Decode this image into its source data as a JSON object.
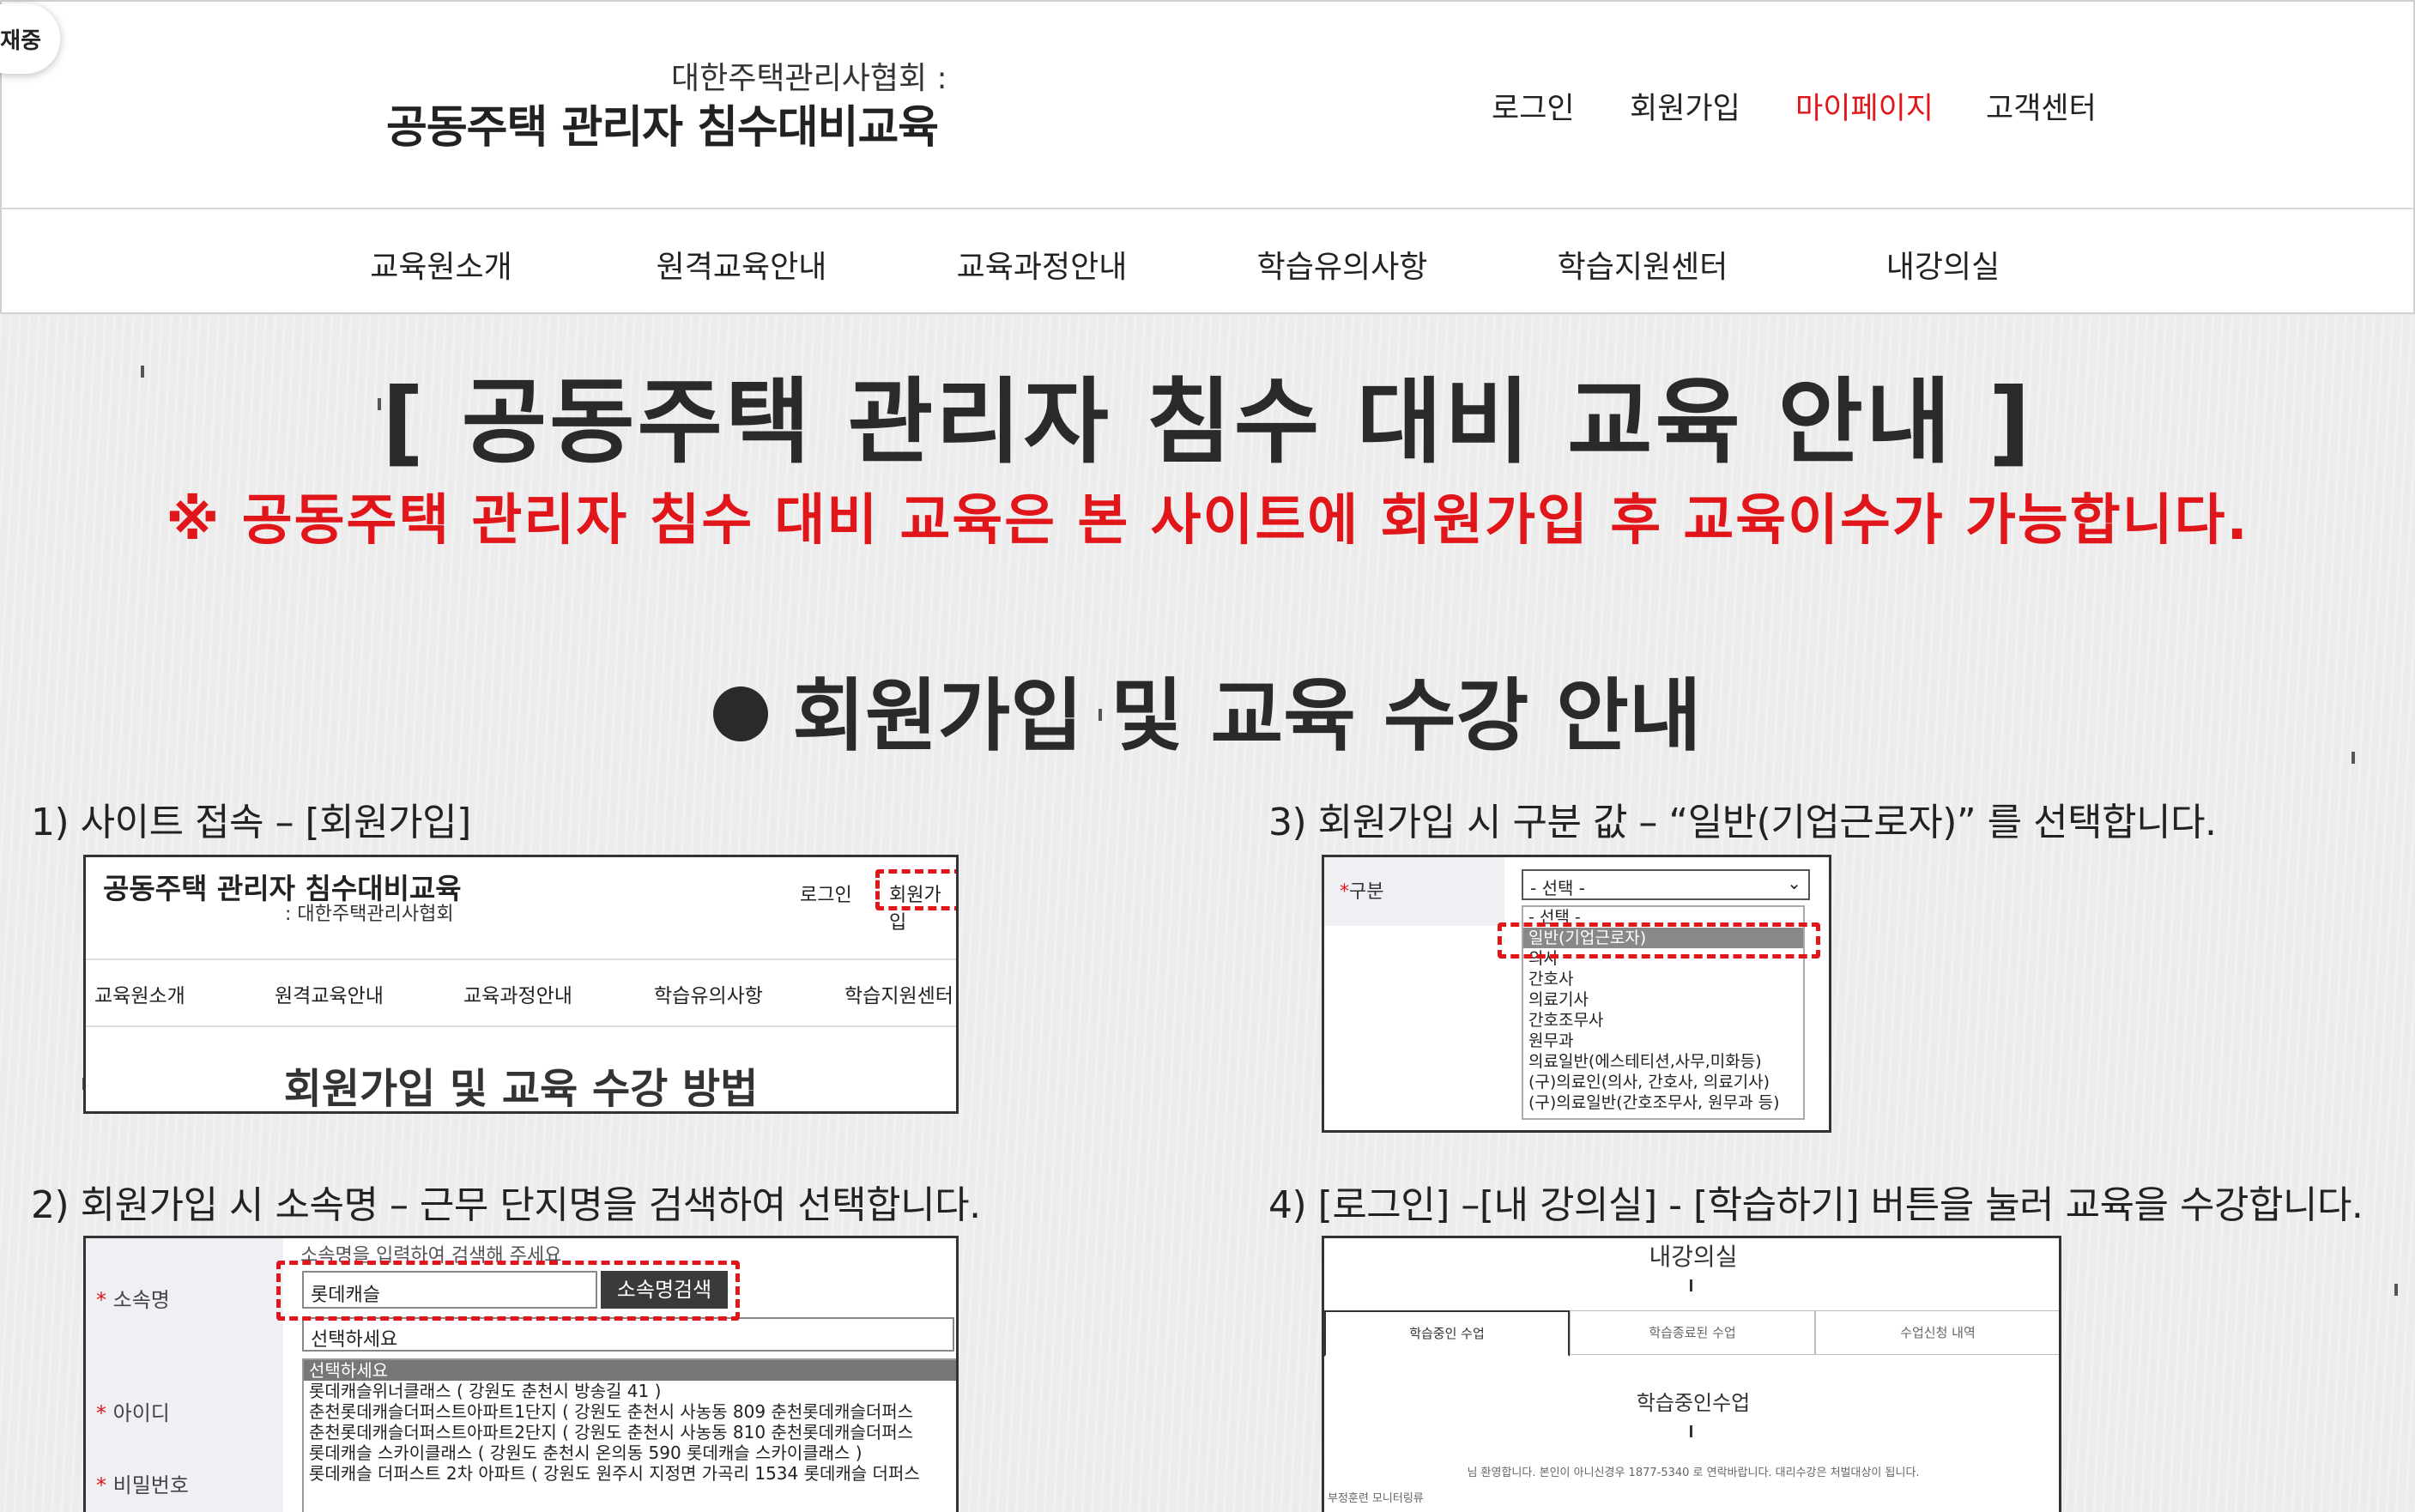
{
  "badge": "재중",
  "header": {
    "logo_sub": "대한주택관리사협회 :",
    "logo_main": "공동주택 관리자 침수대비교육",
    "util": {
      "login": "로그인",
      "join": "회원가입",
      "mypage": "마이페이지",
      "support": "고객센터"
    },
    "accent_color": "#e0161b"
  },
  "gnb": [
    "교육원소개",
    "원격교육안내",
    "교육과정안내",
    "학습유의사항",
    "학습지원센터",
    "내강의실"
  ],
  "main": {
    "title": "[ 공동주택 관리자 침수 대비 교육 안내 ]",
    "notice": "※ 공동주택 관리자 침수 대비 교육은 본 사이트에 회원가입 후 교육이수가 가능합니다.",
    "section_title": "회원가입 및 교육 수강 안내"
  },
  "steps": {
    "step1": "1) 사이트 접속 – [회원가입]",
    "step2": "2) 회원가입 시     소속명 –  근무 단지명을 검색하여 선택합니다.",
    "step3": "3) 회원가입 시 구분 값 – “일반(기업근로자)” 를 선택합니다.",
    "step4": "4) [로그인] –[내 강의실] - [학습하기] 버튼을 눌러 교육을 수강합니다."
  },
  "shot1": {
    "title": "공동주택 관리자 침수대비교육",
    "sub": ": 대한주택관리사협회",
    "login": "로그인",
    "join": "회원가입",
    "nav": [
      "교육원소개",
      "원격교육안내",
      "교육과정안내",
      "학습유의사항",
      "학습지원센터"
    ],
    "heading": "회원가입 및 교육 수강 방법"
  },
  "shot2": {
    "labels": {
      "org": "소속명",
      "id": "아이디",
      "pw": "비밀번호"
    },
    "hint": "소속명을 입력하여 검색해 주세요",
    "input_value": "롯데캐슬",
    "search_button": "소속명검색",
    "select_value": "선택하세요",
    "options": [
      "선택하세요",
      "롯데캐슬위너클래스 ( 강원도 춘천시 방송길 41 )",
      "춘천롯데캐슬더퍼스트아파트1단지 ( 강원도 춘천시 사농동 809 춘천롯데캐슬더퍼스",
      "춘천롯데캐슬더퍼스트아파트2단지 ( 강원도 춘천시 사농동 810 춘천롯데캐슬더퍼스",
      "롯데캐슬 스카이클래스 ( 강원도 춘천시 온의동 590 롯데캐슬 스카이클래스 )",
      "롯데캐슬 더퍼스트 2차 아파트 ( 강원도 원주시 지정면 가곡리 1534 롯데캐슬 더퍼스"
    ]
  },
  "shot3": {
    "label": "구분",
    "select_value": "- 선택 -",
    "options": [
      "- 선택 -",
      "일반(기업근로자)",
      "의사",
      "간호사",
      "의료기사",
      "간호조무사",
      "원무과",
      "의료일반(에스테티션,사무,미화등)",
      "(구)의료인(의사, 간호사, 의료기사)",
      "(구)의료일반(간호조무사, 원무과 등)"
    ],
    "selected_index": 1
  },
  "shot4": {
    "heading": "내강의실",
    "tabs": [
      "학습중인 수업",
      "학습종료된 수업",
      "수업신청 내역"
    ],
    "subheading": "학습중인수업",
    "note": "님 환영합니다. 본인이 아니신경우 1877-5340 로 연락바랍니다. 대리수강은 처벌대상이 됩니다.",
    "footer": "부정훈련 모니터링류"
  }
}
